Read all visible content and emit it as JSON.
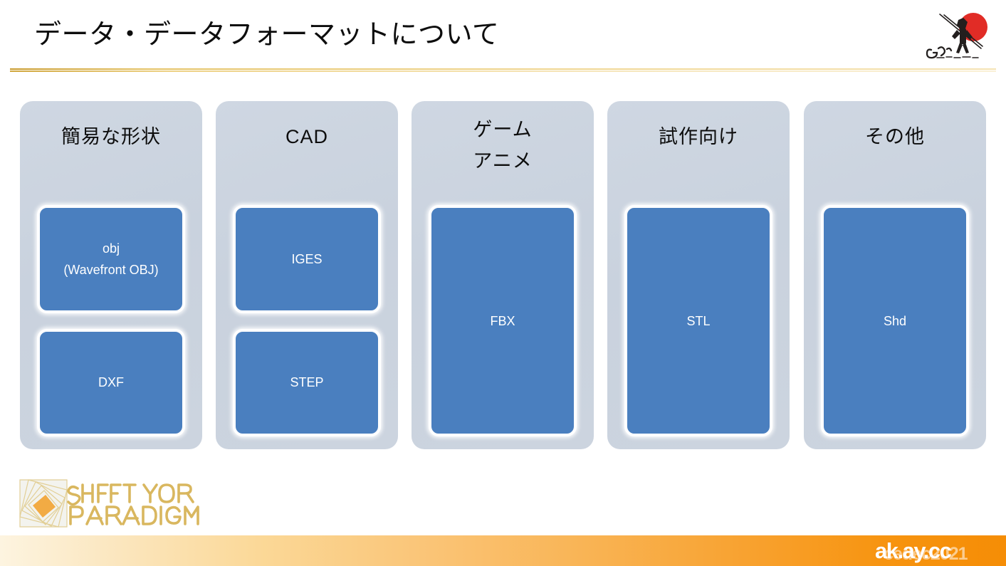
{
  "slide": {
    "title": "データ・データフォーマットについて",
    "background_color": "#ffffff",
    "rule_color": "#d4a93f"
  },
  "brand_logo": {
    "name": "gugen-samurai-logo",
    "sun_color": "#e12c26",
    "ink_color": "#231f1e",
    "script_text": "Gugen"
  },
  "cards": [
    {
      "heading_lines": [
        "簡易な形状"
      ],
      "chips": [
        {
          "label": "obj",
          "sublabel": "(Wavefront OBJ)"
        },
        {
          "label": "DXF",
          "sublabel": ""
        }
      ]
    },
    {
      "heading_lines": [
        "CAD"
      ],
      "chips": [
        {
          "label": "IGES",
          "sublabel": ""
        },
        {
          "label": "STEP",
          "sublabel": ""
        }
      ]
    },
    {
      "heading_lines": [
        "ゲーム",
        "アニメ"
      ],
      "chips": [
        {
          "label": "FBX",
          "sublabel": ""
        }
      ]
    },
    {
      "heading_lines": [
        "試作向け"
      ],
      "chips": [
        {
          "label": "STL",
          "sublabel": ""
        }
      ]
    },
    {
      "heading_lines": [
        "その他"
      ],
      "chips": [
        {
          "label": "Shd",
          "sublabel": ""
        }
      ]
    }
  ],
  "colors": {
    "card_bg": "#ccd4df",
    "chip_bg": "#4a7fbf",
    "chip_border": "#ffffff",
    "chip_text": "#ffffff",
    "heading_text": "#0d0d0d",
    "band_gradient_start": "#fdf4e0",
    "band_gradient_end": "#f58d06"
  },
  "paradigm_logo": {
    "name": "shift-your-paradigm-logo",
    "line1": "SHIFT YOUR",
    "line2": "PARADIGM",
    "text_color": "#d8b45c",
    "mark_color": "#f0a93c"
  },
  "bottom_band": {
    "watermark_back": "cedec2021",
    "watermark_front": "ak.ay.cc"
  }
}
